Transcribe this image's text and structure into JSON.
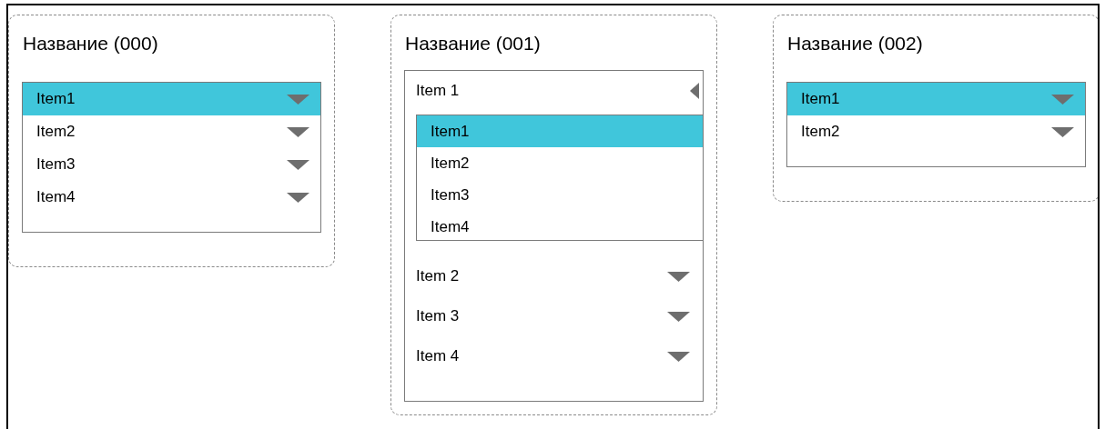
{
  "panels": [
    {
      "kind": "listbox",
      "title": "Название (000)",
      "items": [
        {
          "label": "Item1",
          "selected": true
        },
        {
          "label": "Item2",
          "selected": false
        },
        {
          "label": "Item3",
          "selected": false
        },
        {
          "label": "Item4",
          "selected": false
        }
      ]
    },
    {
      "kind": "expander",
      "title": "Название (001)",
      "items": [
        {
          "label": "Item 1",
          "expanded": true,
          "children": [
            {
              "label": "Item1",
              "selected": true
            },
            {
              "label": "Item2",
              "selected": false
            },
            {
              "label": "Item3",
              "selected": false
            },
            {
              "label": "Item4",
              "selected": false
            }
          ]
        },
        {
          "label": "Item 2",
          "expanded": false
        },
        {
          "label": "Item 3",
          "expanded": false
        },
        {
          "label": "Item 4",
          "expanded": false
        }
      ]
    },
    {
      "kind": "listbox",
      "title": "Название (002)",
      "items": [
        {
          "label": "Item1",
          "selected": true
        },
        {
          "label": "Item2",
          "selected": false
        }
      ]
    }
  ]
}
